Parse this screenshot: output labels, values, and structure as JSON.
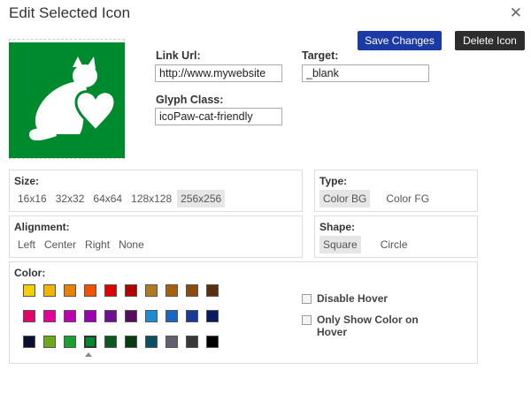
{
  "dialog": {
    "title": "Edit Selected Icon",
    "close": "✕"
  },
  "actions": {
    "save_label": "Save Changes",
    "delete_label": "Delete Icon"
  },
  "fields": {
    "link_url": {
      "label": "Link Url:",
      "value": "http://www.mywebsite"
    },
    "target": {
      "label": "Target:",
      "value": "_blank"
    },
    "glyph_class": {
      "label": "Glyph Class:",
      "value": "icoPaw-cat-friendly"
    }
  },
  "preview": {
    "icon": "cat-heart-icon",
    "background": "#008a2e"
  },
  "size": {
    "title": "Size:",
    "options": [
      "16x16",
      "32x32",
      "64x64",
      "128x128",
      "256x256"
    ],
    "selected": "256x256"
  },
  "type": {
    "title": "Type:",
    "options": [
      "Color BG",
      "Color FG"
    ],
    "selected": "Color BG"
  },
  "alignment": {
    "title": "Alignment:",
    "options": [
      "Left",
      "Center",
      "Right",
      "None"
    ]
  },
  "shape": {
    "title": "Shape:",
    "options": [
      "Square",
      "Circle"
    ],
    "selected": "Square"
  },
  "color": {
    "title": "Color:",
    "rows": [
      [
        "#f5d000",
        "#f0b400",
        "#ee8000",
        "#f05200",
        "#e00000",
        "#b00000",
        "#b07a20",
        "#a86010",
        "#8a4a10",
        "#5a3010"
      ],
      [
        "#e8006a",
        "#e8009a",
        "#c000b0",
        "#9a00b0",
        "#701090",
        "#5a0a5a",
        "#1e8ad8",
        "#1a66c0",
        "#1a3a9a",
        "#0a1a60"
      ],
      [
        "#0a1030",
        "#6aa820",
        "#18a030",
        "#008a2e",
        "#0a5a20",
        "#0a3a10",
        "#0a5060",
        "#606070",
        "#383838",
        "#000000"
      ]
    ],
    "selected": "#008a2e"
  },
  "options": {
    "disable_hover": "Disable Hover",
    "only_show_color_hover": "Only Show Color on Hover"
  }
}
